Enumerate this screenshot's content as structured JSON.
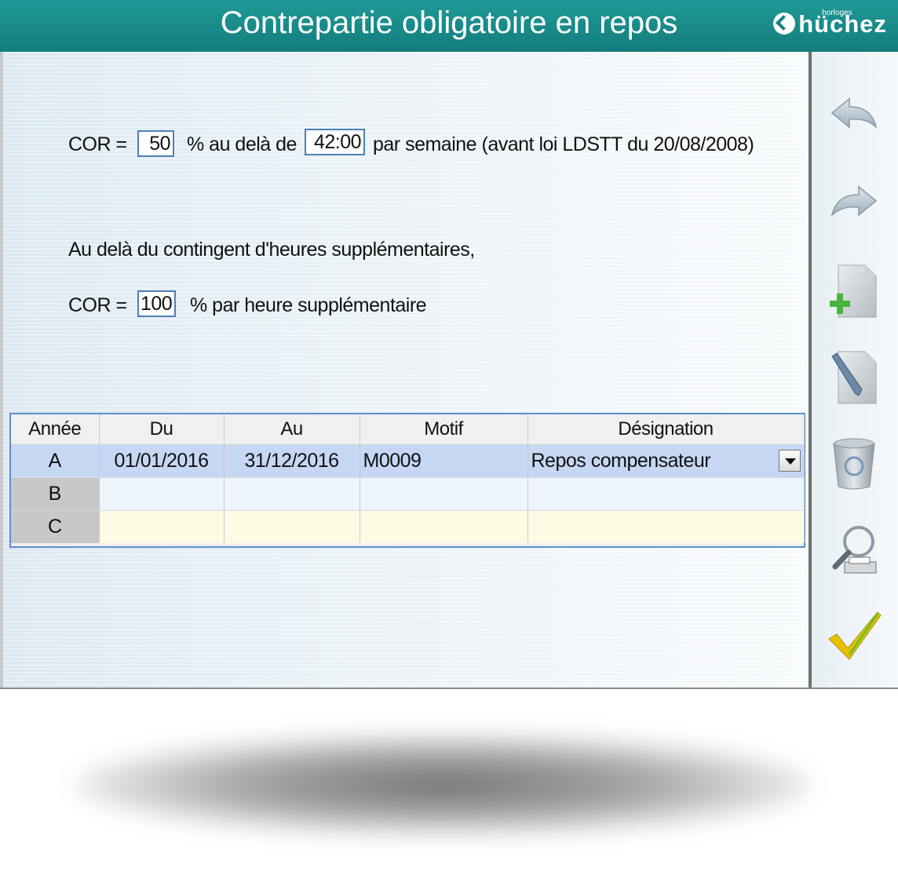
{
  "header": {
    "title": "Contrepartie obligatoire en repos",
    "logo_small": "horloges",
    "logo_main": "hüchez"
  },
  "form": {
    "line1": {
      "label_cor": "COR =",
      "value_pct": "50",
      "label_beyond": "% au delà de",
      "value_hours": "42:00",
      "label_week": "par semaine (avant loi LDSTT du 20/08/2008)"
    },
    "note": "Au delà du contingent d'heures supplémentaires,",
    "line2": {
      "label_cor": "COR =",
      "value_pct": "100",
      "label_per_hour": "% par heure supplémentaire"
    }
  },
  "grid": {
    "columns": [
      "Année",
      "Du",
      "Au",
      "Motif",
      "Désignation"
    ],
    "rows": [
      {
        "year": "A",
        "from": "01/01/2016",
        "to": "31/12/2016",
        "motif": "M0009",
        "designation": "Repos compensateur"
      },
      {
        "year": "B",
        "from": "",
        "to": "",
        "motif": "",
        "designation": ""
      },
      {
        "year": "C",
        "from": "",
        "to": "",
        "motif": "",
        "designation": ""
      }
    ]
  },
  "toolbar": {
    "icons": [
      "undo-arrow-icon",
      "redo-arrow-icon",
      "new-document-icon",
      "edit-document-icon",
      "recycle-bin-icon",
      "print-preview-icon",
      "validate-check-icon"
    ]
  },
  "colors": {
    "titlebar": "#1a8d8c",
    "grid_border": "#5b8fd0",
    "selected_row": "#c5d7f3"
  }
}
